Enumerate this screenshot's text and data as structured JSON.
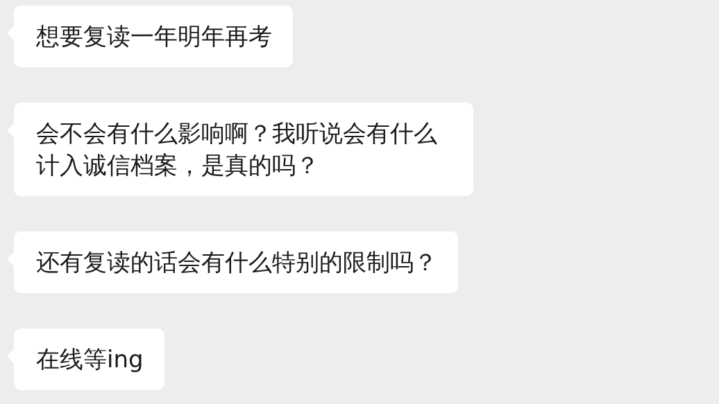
{
  "messages": [
    {
      "text": "想要复读一年明年再考"
    },
    {
      "text": "会不会有什么影响啊？我听说会有什么计入诚信档案，是真的吗？"
    },
    {
      "text": "还有复读的话会有什么特别的限制吗？"
    },
    {
      "text": "在线等ing"
    }
  ]
}
